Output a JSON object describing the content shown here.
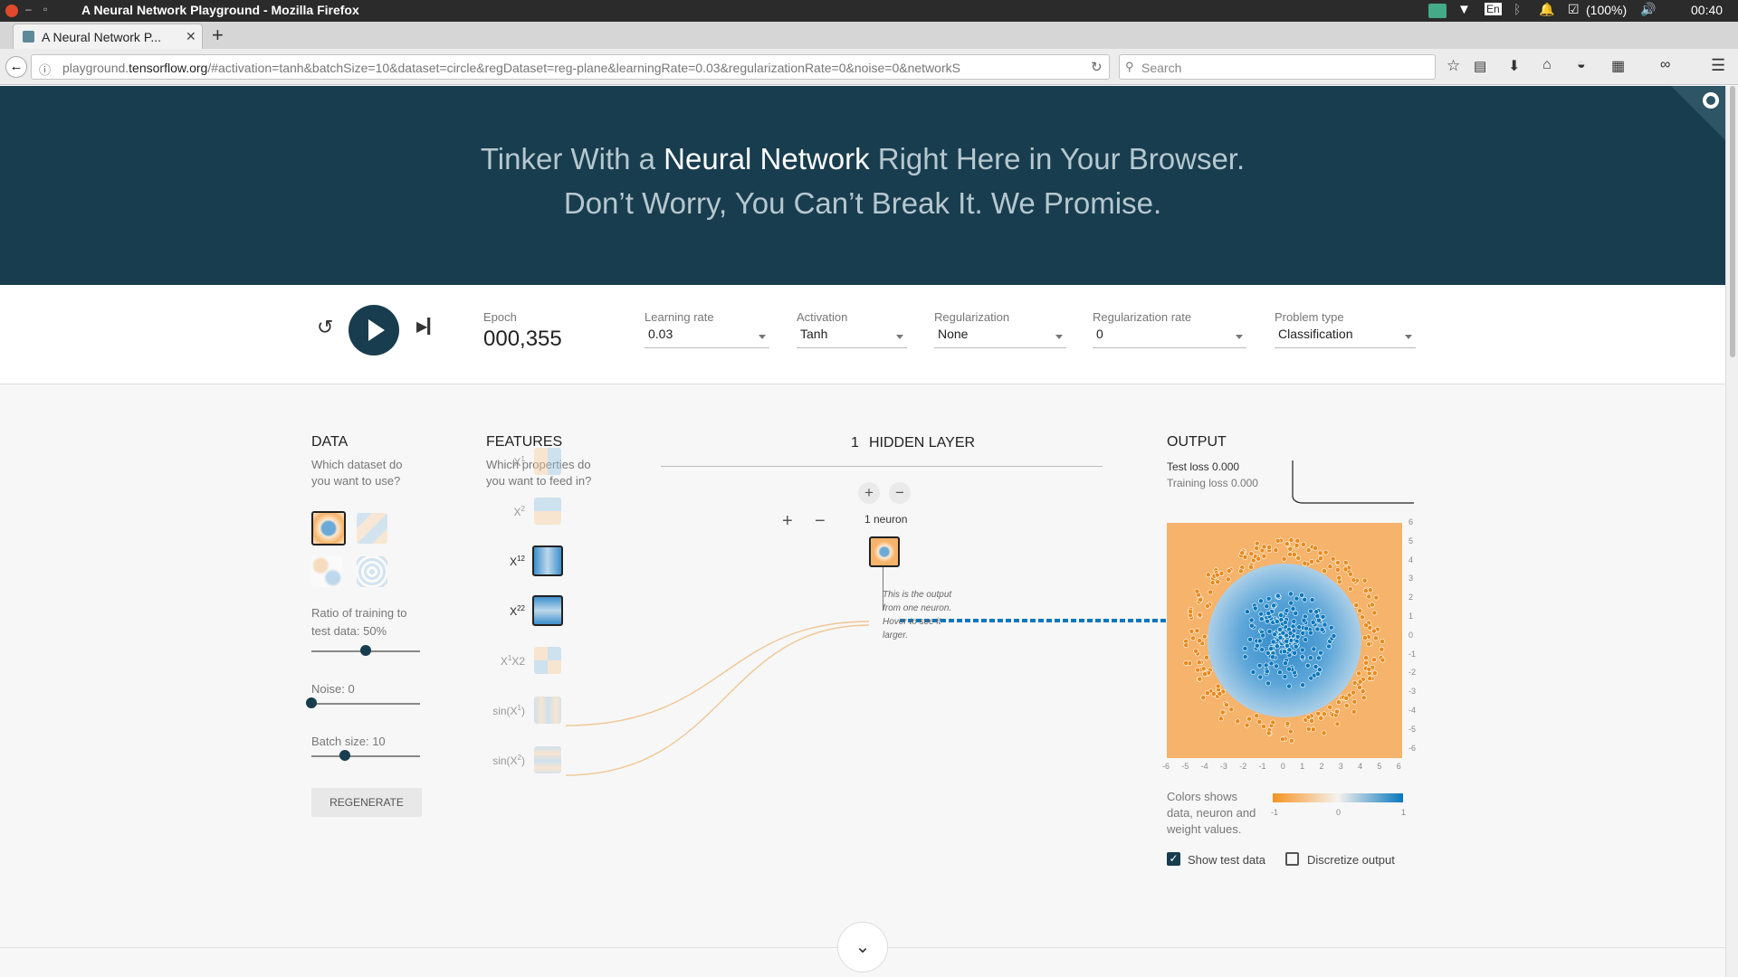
{
  "os_bar": {
    "window_title": "A Neural Network Playground - Mozilla Firefox",
    "battery": "(100%)",
    "time": "00:40",
    "keyboard": "En"
  },
  "browser": {
    "tab_title": "A Neural Network P...",
    "url_host": "playground.",
    "url_domain": "tensorflow.org",
    "url_rest": "/#activation=tanh&batchSize=10&dataset=circle&regDataset=reg-plane&learningRate=0.03&regularizationRate=0&noise=0&networkS",
    "search_placeholder": "Search"
  },
  "hero": {
    "line1_a": "Tinker With a ",
    "line1_b": "Neural Network",
    "line1_c": " Right Here in Your Browser.",
    "line2": "Don’t Worry, You Can’t Break It. We Promise."
  },
  "controls": {
    "epoch_label": "Epoch",
    "epoch_value": "000,355",
    "learning_rate_label": "Learning rate",
    "learning_rate_value": "0.03",
    "activation_label": "Activation",
    "activation_value": "Tanh",
    "regularization_label": "Regularization",
    "regularization_value": "None",
    "reg_rate_label": "Regularization rate",
    "reg_rate_value": "0",
    "problem_label": "Problem type",
    "problem_value": "Classification"
  },
  "data_panel": {
    "title": "DATA",
    "desc1": "Which dataset do",
    "desc2": "you want to use?",
    "ratio_label1": "Ratio of training to",
    "ratio_label2": "test data:  50%",
    "ratio_fraction": 0.5,
    "noise_label": "Noise:  0",
    "noise_fraction": 0,
    "batch_label": "Batch size:  10",
    "batch_fraction": 0.31,
    "regenerate": "REGENERATE"
  },
  "features_panel": {
    "title": "FEATURES",
    "desc1": "Which properties do",
    "desc2": "you want to feed in?",
    "items": [
      {
        "base": "X",
        "sup": "1",
        "sub_after": "",
        "active": false
      },
      {
        "base": "X",
        "sup": "2",
        "sub_after": "",
        "active": false
      },
      {
        "base": "X",
        "sup": "1",
        "sub_after": "2",
        "active": true
      },
      {
        "base": "X",
        "sup": "2",
        "sub_after": "2",
        "active": true
      },
      {
        "base": "X",
        "sup": "1",
        "sub_after": "X2",
        "active": false
      },
      {
        "base": "sin(X",
        "sup": "1",
        "sub_after": ")",
        "active": false
      },
      {
        "base": "sin(X",
        "sup": "2",
        "sub_after": ")",
        "active": false
      }
    ]
  },
  "network": {
    "layer_count": "1",
    "layer_label": "HIDDEN LAYER",
    "neuron_label": "1 neuron",
    "tooltip1": "This is the output",
    "tooltip2": "from one neuron.",
    "tooltip3": "Hover to see it",
    "tooltip4": "larger."
  },
  "output_panel": {
    "title": "OUTPUT",
    "test_loss_label": "Test loss",
    "test_loss_value": "0.000",
    "train_loss_label": "Training loss",
    "train_loss_value": "0.000",
    "y_ticks": [
      "6",
      "5",
      "4",
      "3",
      "2",
      "1",
      "0",
      "-1",
      "-2",
      "-3",
      "-4",
      "-5",
      "-6"
    ],
    "x_ticks": [
      "-6",
      "-5",
      "-4",
      "-3",
      "-2",
      "-1",
      "0",
      "1",
      "2",
      "3",
      "4",
      "5",
      "6"
    ],
    "legend1": "Colors shows",
    "legend2": "data, neuron and",
    "legend3": "weight values.",
    "scale_min": "-1",
    "scale_mid": "0",
    "scale_max": "1",
    "show_test_data": "Show test data",
    "show_test_checked": true,
    "discretize": "Discretize output",
    "discretize_checked": false
  },
  "colors": {
    "orange": "#f59322",
    "blue": "#0877bd",
    "hero_bg": "#183d4e"
  }
}
